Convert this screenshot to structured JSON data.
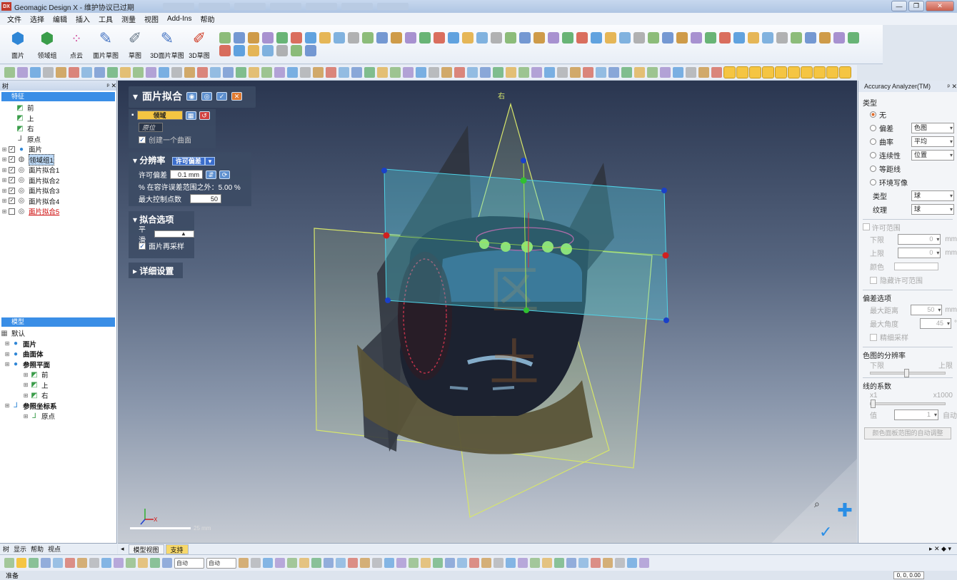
{
  "window": {
    "logo": "DX",
    "title": "Geomagic Design X - 维护协议已过期",
    "buttons": {
      "minimize": "—",
      "restore": "❐",
      "close": "✕"
    }
  },
  "menu": [
    "文件",
    "选择",
    "编辑",
    "插入",
    "工具",
    "测量",
    "视图",
    "Add-Ins",
    "帮助"
  ],
  "ribbon": [
    {
      "label": "面片",
      "icon": "mesh-icon"
    },
    {
      "label": "领域组",
      "icon": "region-group-icon"
    },
    {
      "label": "点云",
      "icon": "point-cloud-icon"
    },
    {
      "label": "面片草图",
      "icon": "mesh-sketch-icon"
    },
    {
      "label": "草图",
      "icon": "sketch-icon"
    },
    {
      "label": "3D面片草图",
      "icon": "3d-mesh-sketch-icon"
    },
    {
      "label": "3D草图",
      "icon": "3d-sketch-icon"
    }
  ],
  "feature_tree": {
    "title": "树",
    "header": "特征",
    "items": [
      {
        "label": "前",
        "icon": "plane-icon"
      },
      {
        "label": "上",
        "icon": "plane-icon"
      },
      {
        "label": "右",
        "icon": "plane-icon"
      },
      {
        "label": "原点",
        "icon": "origin-icon"
      },
      {
        "label": "面片",
        "icon": "mesh-icon"
      },
      {
        "label": "领域组1",
        "icon": "region-group-icon"
      },
      {
        "label": "面片拟合1",
        "icon": "mesh-fit-icon"
      },
      {
        "label": "面片拟合2",
        "icon": "mesh-fit-icon"
      },
      {
        "label": "面片拟合3",
        "icon": "mesh-fit-icon"
      },
      {
        "label": "面片拟合4",
        "icon": "mesh-fit-icon"
      },
      {
        "label": "面片拟合5",
        "icon": "mesh-fit-icon"
      }
    ]
  },
  "model_tree": {
    "header": "模型",
    "root": "默认",
    "items": [
      {
        "label": "面片",
        "level": 1
      },
      {
        "label": "曲面体",
        "level": 1
      },
      {
        "label": "参照平面",
        "level": 1
      },
      {
        "label": "前",
        "level": 2
      },
      {
        "label": "上",
        "level": 2
      },
      {
        "label": "右",
        "level": 2
      },
      {
        "label": "参照坐标系",
        "level": 1
      },
      {
        "label": "原点",
        "level": 2
      }
    ]
  },
  "left_tabs": [
    "树",
    "显示",
    "帮助",
    "视点"
  ],
  "op_panel": {
    "title": "面片拟合",
    "region_label": "领域",
    "origin_label": "原位",
    "create_single": "创建一个曲面",
    "resolution_section": "分辨率",
    "resolution_mode": "许可偏差",
    "tolerance_label": "许可偏差",
    "tolerance_value": "0.1 mm",
    "outside_text": "% 在容许误差范围之外：5.00 %",
    "max_ctrl_label": "最大控制点数",
    "max_ctrl_value": "50",
    "fit_options_section": "拟合选项",
    "smooth_label": "平滑",
    "resample_label": "面片再采样",
    "detail_section": "详细设置"
  },
  "viewport": {
    "plane_label": "右",
    "scale_label": "25",
    "scale_unit": "mm"
  },
  "accuracy": {
    "title": "Accuracy Analyzer(TM)",
    "type_section": "类型",
    "options": [
      {
        "label": "无",
        "on": true,
        "select": ""
      },
      {
        "label": "偏差",
        "on": false,
        "select": "色图"
      },
      {
        "label": "曲率",
        "on": false,
        "select": "平均"
      },
      {
        "label": "连续性",
        "on": false,
        "select": "位置"
      },
      {
        "label": "等距线",
        "on": false,
        "select": ""
      },
      {
        "label": "环境写像",
        "on": false,
        "select": ""
      }
    ],
    "subtype_label": "类型",
    "subtype_value": "球",
    "texture_label": "纹理",
    "texture_value": "球",
    "allow_range": "许可范围",
    "lower_label": "下限",
    "lower_value": "0",
    "upper_label": "上限",
    "upper_value": "0",
    "unit": "mm",
    "color_label": "颜色",
    "hide_allow": "隐藏许可范围",
    "dev_options": "偏差选项",
    "max_dist_label": "最大距离",
    "max_dist_value": "50",
    "max_angle_label": "最大角度",
    "max_angle_value": "45",
    "fine_sample": "精细采样",
    "color_res": "色图的分辨率",
    "color_low": "下限",
    "color_high": "上限",
    "line_factor": "线的系数",
    "factor_min": "x1",
    "factor_max": "x1000",
    "value_label": "值",
    "value_val": "1",
    "auto_label": "自动",
    "auto_button": "颜色面板范围的自动调整"
  },
  "view_tabs": [
    "模型视图",
    "支持"
  ],
  "status_combos": [
    "自动",
    "自动"
  ],
  "status": {
    "text": "准备",
    "coords": "0, 0, 0.00"
  },
  "colors": {
    "accent": "#3a8ee6",
    "plane_cyan": "#4fd2e6",
    "plane_yellow": "#d7e66a",
    "fit_highlight": "#f7d86a"
  }
}
